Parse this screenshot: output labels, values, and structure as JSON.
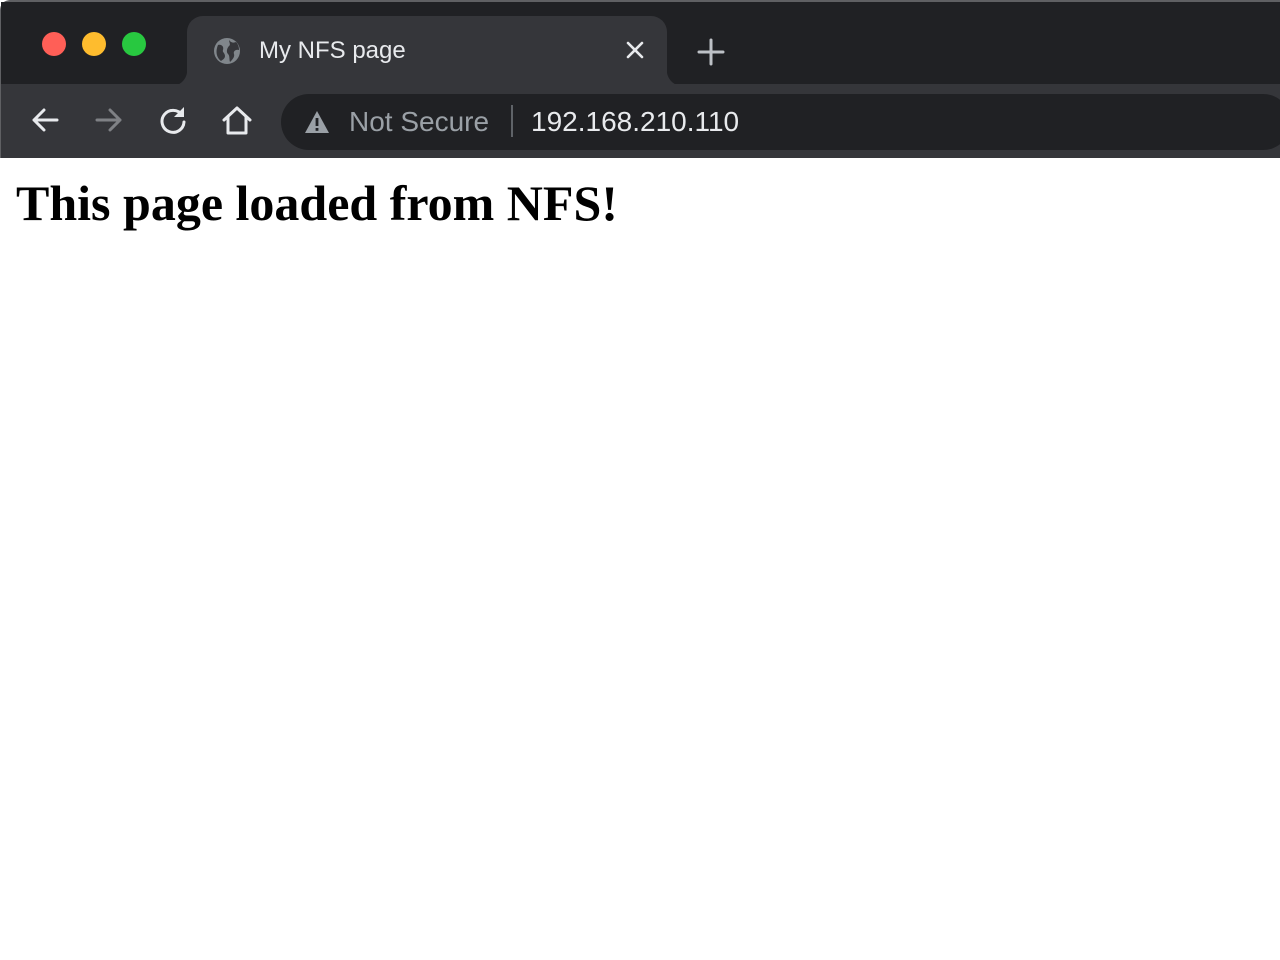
{
  "window": {
    "traffic_lights": {
      "close_color": "#ff5f57",
      "minimize_color": "#febc2e",
      "zoom_color": "#28c840"
    }
  },
  "tabs": [
    {
      "title": "My NFS page",
      "favicon": "globe-icon",
      "active": true
    }
  ],
  "toolbar": {
    "back_icon": "arrow-left-icon",
    "forward_icon": "arrow-right-icon",
    "reload_icon": "reload-icon",
    "home_icon": "home-icon"
  },
  "omnibox": {
    "security_icon": "warning-triangle-icon",
    "security_label": "Not Secure",
    "url": "192.168.210.110"
  },
  "page": {
    "heading": "This page loaded from NFS!"
  }
}
